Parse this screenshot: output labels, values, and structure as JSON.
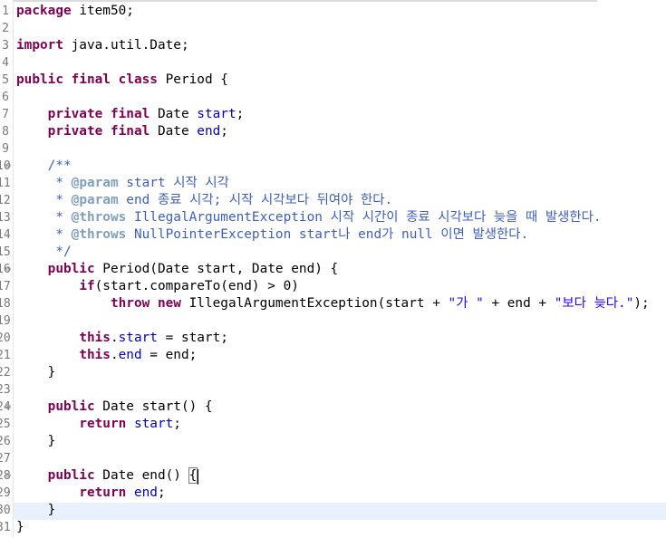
{
  "editor": {
    "lines": [
      {
        "num": "1",
        "fold": "",
        "segments": [
          {
            "t": "package",
            "c": "kw"
          },
          {
            "t": " item50;",
            "c": ""
          }
        ]
      },
      {
        "num": "2",
        "fold": "",
        "segments": []
      },
      {
        "num": "3",
        "fold": "",
        "segments": [
          {
            "t": "import",
            "c": "kw"
          },
          {
            "t": " java.util.Date;",
            "c": ""
          }
        ]
      },
      {
        "num": "4",
        "fold": "",
        "segments": []
      },
      {
        "num": "5",
        "fold": "",
        "segments": [
          {
            "t": "public",
            "c": "kw"
          },
          {
            "t": " ",
            "c": ""
          },
          {
            "t": "final",
            "c": "kw"
          },
          {
            "t": " ",
            "c": ""
          },
          {
            "t": "class",
            "c": "kw"
          },
          {
            "t": " Period {",
            "c": ""
          }
        ]
      },
      {
        "num": "6",
        "fold": "",
        "segments": []
      },
      {
        "num": "7",
        "fold": "",
        "segments": [
          {
            "t": "    ",
            "c": ""
          },
          {
            "t": "private",
            "c": "kw"
          },
          {
            "t": " ",
            "c": ""
          },
          {
            "t": "final",
            "c": "kw"
          },
          {
            "t": " Date ",
            "c": ""
          },
          {
            "t": "start",
            "c": "fld"
          },
          {
            "t": ";",
            "c": ""
          }
        ]
      },
      {
        "num": "8",
        "fold": "",
        "segments": [
          {
            "t": "    ",
            "c": ""
          },
          {
            "t": "private",
            "c": "kw"
          },
          {
            "t": " ",
            "c": ""
          },
          {
            "t": "final",
            "c": "kw"
          },
          {
            "t": " Date ",
            "c": ""
          },
          {
            "t": "end",
            "c": "fld"
          },
          {
            "t": ";",
            "c": ""
          }
        ]
      },
      {
        "num": "9",
        "fold": "",
        "segments": []
      },
      {
        "num": "10",
        "fold": "⊖",
        "segments": [
          {
            "t": "    /**",
            "c": "cm"
          }
        ]
      },
      {
        "num": "11",
        "fold": "",
        "segments": [
          {
            "t": "     * ",
            "c": "cm"
          },
          {
            "t": "@param",
            "c": "tag"
          },
          {
            "t": " start 시작 시각",
            "c": "cm"
          }
        ]
      },
      {
        "num": "12",
        "fold": "",
        "segments": [
          {
            "t": "     * ",
            "c": "cm"
          },
          {
            "t": "@param",
            "c": "tag"
          },
          {
            "t": " end 종료 시각; 시작 시각보다 뒤여야 한다.",
            "c": "cm"
          }
        ]
      },
      {
        "num": "13",
        "fold": "",
        "segments": [
          {
            "t": "     * ",
            "c": "cm"
          },
          {
            "t": "@throws",
            "c": "tag"
          },
          {
            "t": " IllegalArgumentException 시작 시간이 종료 시각보다 늦을 때 발생한다.",
            "c": "cm"
          }
        ]
      },
      {
        "num": "14",
        "fold": "",
        "segments": [
          {
            "t": "     * ",
            "c": "cm"
          },
          {
            "t": "@throws",
            "c": "tag"
          },
          {
            "t": " NullPointerException start나 end가 null 이면 발생한다.",
            "c": "cm"
          }
        ]
      },
      {
        "num": "15",
        "fold": "",
        "segments": [
          {
            "t": "     */",
            "c": "cm"
          }
        ]
      },
      {
        "num": "16",
        "fold": "⊖",
        "segments": [
          {
            "t": "    ",
            "c": ""
          },
          {
            "t": "public",
            "c": "kw"
          },
          {
            "t": " Period(Date start, Date end) {",
            "c": ""
          }
        ]
      },
      {
        "num": "17",
        "fold": "",
        "segments": [
          {
            "t": "        ",
            "c": ""
          },
          {
            "t": "if",
            "c": "kw"
          },
          {
            "t": "(start.compareTo(end) > 0)",
            "c": ""
          }
        ]
      },
      {
        "num": "18",
        "fold": "",
        "segments": [
          {
            "t": "            ",
            "c": ""
          },
          {
            "t": "throw",
            "c": "kw"
          },
          {
            "t": " ",
            "c": ""
          },
          {
            "t": "new",
            "c": "kw"
          },
          {
            "t": " IllegalArgumentException(start + ",
            "c": ""
          },
          {
            "t": "\"가 \"",
            "c": "str"
          },
          {
            "t": " + end + ",
            "c": ""
          },
          {
            "t": "\"보다 늦다.\"",
            "c": "str"
          },
          {
            "t": ");",
            "c": ""
          }
        ]
      },
      {
        "num": "19",
        "fold": "",
        "segments": []
      },
      {
        "num": "20",
        "fold": "",
        "segments": [
          {
            "t": "        ",
            "c": ""
          },
          {
            "t": "this",
            "c": "kw"
          },
          {
            "t": ".",
            "c": ""
          },
          {
            "t": "start",
            "c": "fld"
          },
          {
            "t": " = start;",
            "c": ""
          }
        ]
      },
      {
        "num": "21",
        "fold": "",
        "segments": [
          {
            "t": "        ",
            "c": ""
          },
          {
            "t": "this",
            "c": "kw"
          },
          {
            "t": ".",
            "c": ""
          },
          {
            "t": "end",
            "c": "fld"
          },
          {
            "t": " = end;",
            "c": ""
          }
        ]
      },
      {
        "num": "22",
        "fold": "",
        "segments": [
          {
            "t": "    }",
            "c": ""
          }
        ]
      },
      {
        "num": "23",
        "fold": "",
        "segments": []
      },
      {
        "num": "24",
        "fold": "⊖",
        "segments": [
          {
            "t": "    ",
            "c": ""
          },
          {
            "t": "public",
            "c": "kw"
          },
          {
            "t": " Date start() {",
            "c": ""
          }
        ]
      },
      {
        "num": "25",
        "fold": "",
        "segments": [
          {
            "t": "        ",
            "c": ""
          },
          {
            "t": "return",
            "c": "kw"
          },
          {
            "t": " ",
            "c": ""
          },
          {
            "t": "start",
            "c": "fld"
          },
          {
            "t": ";",
            "c": ""
          }
        ]
      },
      {
        "num": "26",
        "fold": "",
        "segments": [
          {
            "t": "    }",
            "c": ""
          }
        ]
      },
      {
        "num": "27",
        "fold": "",
        "segments": []
      },
      {
        "num": "28",
        "fold": "⊖",
        "segments": [
          {
            "t": "    ",
            "c": ""
          },
          {
            "t": "public",
            "c": "kw"
          },
          {
            "t": " Date end() ",
            "c": ""
          },
          {
            "t": "{",
            "c": "brk"
          }
        ]
      },
      {
        "num": "29",
        "fold": "",
        "segments": [
          {
            "t": "        ",
            "c": ""
          },
          {
            "t": "return",
            "c": "kw"
          },
          {
            "t": " ",
            "c": ""
          },
          {
            "t": "end",
            "c": "fld"
          },
          {
            "t": ";",
            "c": ""
          }
        ]
      },
      {
        "num": "30",
        "fold": "",
        "segments": [
          {
            "t": "    }",
            "c": ""
          }
        ]
      },
      {
        "num": "31",
        "fold": "",
        "segments": [
          {
            "t": "}",
            "c": ""
          }
        ]
      }
    ],
    "colors": {
      "keyword": "#7f0055",
      "field": "#0000c0",
      "comment": "#3f5fbf",
      "javadoc_tag": "#7f9fbf",
      "string": "#2a00ff",
      "current_line": "#e8f2fe"
    }
  }
}
